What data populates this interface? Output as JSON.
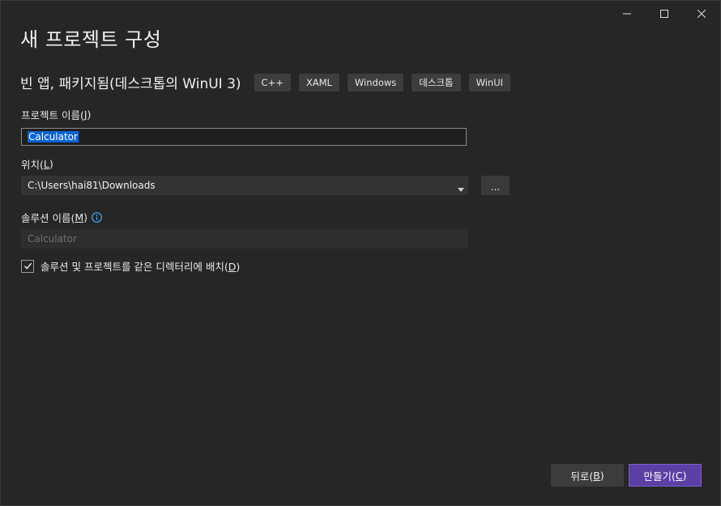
{
  "window": {
    "controls": {
      "minimize_icon": "minimize-icon",
      "maximize_icon": "maximize-icon",
      "close_icon": "close-icon"
    }
  },
  "header": {
    "title": "새 프로젝트 구성",
    "template_name": "빈 앱, 패키지됨(데스크톱의 WinUI 3)",
    "tags": [
      "C++",
      "XAML",
      "Windows",
      "데스크톱",
      "WinUI"
    ]
  },
  "form": {
    "project_name": {
      "label": "프로젝트 이름(",
      "accel": "J",
      "label_end": ")",
      "value": "Calculator"
    },
    "location": {
      "label": "위치(",
      "accel": "L",
      "label_end": ")",
      "value": "C:\\Users\\hai81\\Downloads",
      "browse_label": "..."
    },
    "solution_name": {
      "label": "솔루션 이름(",
      "accel": "M",
      "label_end": ")",
      "value": "Calculator",
      "info_icon": "info-icon"
    },
    "same_dir": {
      "checked": true,
      "label": "솔루션 및 프로젝트를 같은 디렉터리에 배치(",
      "accel": "D",
      "label_end": ")"
    }
  },
  "footer": {
    "back": {
      "label": "뒤로(",
      "accel": "B",
      "label_end": ")"
    },
    "create": {
      "label": "만들기(",
      "accel": "C",
      "label_end": ")"
    }
  },
  "colors": {
    "background": "#262626",
    "accent": "#5b3fa5",
    "selection": "#0a64d6",
    "info": "#4ea6f0"
  }
}
